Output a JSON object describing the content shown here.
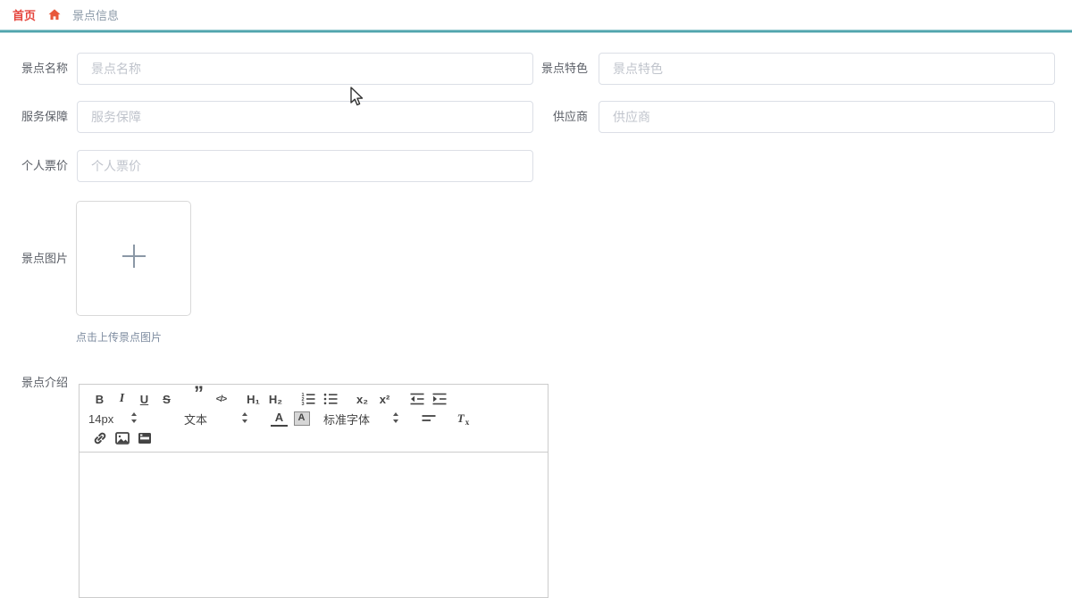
{
  "breadcrumb": {
    "home": "首页",
    "current": "景点信息"
  },
  "colors": {
    "accent_line": "#4da3ab",
    "breadcrumb_home": "#e5443c",
    "home_icon": "#e8583b",
    "breadcrumb_current": "#8c9aa8",
    "upload_hint": "#7e8ca0",
    "input_border": "#dcdfe6",
    "placeholder": "#c0c4cc"
  },
  "form": {
    "fields": {
      "name": {
        "label": "景点名称",
        "placeholder": "景点名称",
        "value": ""
      },
      "feature": {
        "label": "景点特色",
        "placeholder": "景点特色",
        "value": ""
      },
      "service": {
        "label": "服务保障",
        "placeholder": "服务保障",
        "value": ""
      },
      "supplier": {
        "label": "供应商",
        "placeholder": "供应商",
        "value": ""
      },
      "price": {
        "label": "个人票价",
        "placeholder": "个人票价",
        "value": ""
      }
    },
    "upload": {
      "label": "景点图片",
      "hint": "点击上传景点图片"
    },
    "editor": {
      "label": "景点介绍",
      "content": "",
      "toolbar": {
        "bold": "B",
        "italic": "I",
        "underline": "U",
        "strike": "S",
        "quote": "”",
        "code": "</>",
        "h1": "H₁",
        "h2": "H₂",
        "subscript": "x₂",
        "superscript": "x²",
        "size": "14px",
        "header": "文本",
        "color": "A",
        "background": "A",
        "font": "标准字体",
        "clean_t": "T",
        "clean_x": "x"
      }
    }
  }
}
